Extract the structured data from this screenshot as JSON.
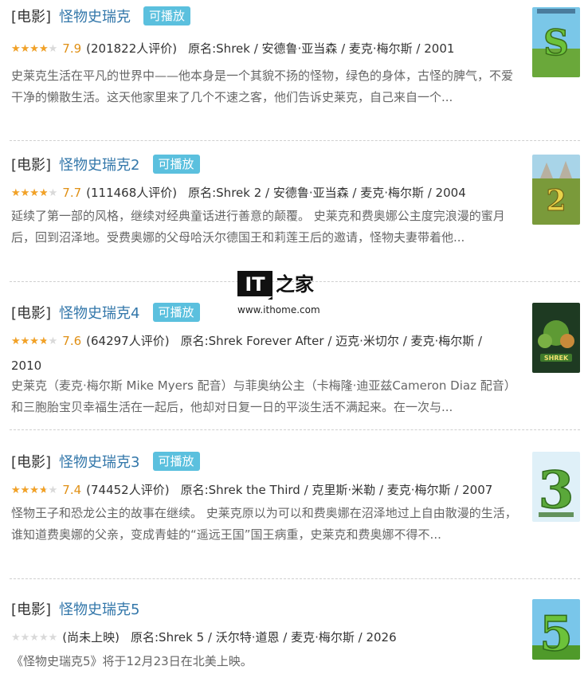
{
  "results": [
    {
      "category": "[电影]",
      "title": "怪物史瑞克",
      "badge": "可播放",
      "rating": 0.79,
      "score": "7.9",
      "votes": "(201822人评价)",
      "original": "原名:Shrek / 安德鲁·亚当森 / 麦克·梅尔斯 / 2001",
      "description": "史莱克生活在平凡的世界中——他本身是一个其貌不扬的怪物，绿色的身体，古怪的脾气，不爱干净的懒散生活。这天他家里来了几个不速之客，他们告诉史莱克，自己来自一个...",
      "poster_number": "",
      "poster_colors": [
        "#7ac7e8",
        "#6aa83a"
      ]
    },
    {
      "category": "[电影]",
      "title": "怪物史瑞克2",
      "badge": "可播放",
      "rating": 0.77,
      "score": "7.7",
      "votes": "(111468人评价)",
      "original": "原名:Shrek 2 / 安德鲁·亚当森 / 麦克·梅尔斯 / 2004",
      "description": "延续了第一部的风格，继续对经典童话进行善意的颠覆。 史莱克和费奥娜公主度完浪漫的蜜月后，回到沼泽地。受费奥娜的父母哈沃尔德国王和莉莲王后的邀请，怪物夫妻带着他...",
      "poster_number": "2",
      "poster_colors": [
        "#a8d4e8",
        "#7a9a3a"
      ]
    },
    {
      "category": "[电影]",
      "title": "怪物史瑞克4",
      "badge": "可播放",
      "rating": 0.76,
      "score": "7.6",
      "votes": "(64297人评价)",
      "original": "原名:Shrek Forever After / 迈克·米切尔 / 麦克·梅尔斯 / 2010",
      "description": "史莱克（麦克·梅尔斯 Mike Myers 配音）与菲奥纳公主（卡梅隆·迪亚兹Cameron Diaz 配音）和三胞胎宝贝幸福生活在一起后，他却对日复一日的平淡生活不满起来。在一次与...",
      "poster_number": "",
      "poster_colors": [
        "#1e3a22",
        "#3f7a2c"
      ]
    },
    {
      "category": "[电影]",
      "title": "怪物史瑞克3",
      "badge": "可播放",
      "rating": 0.74,
      "score": "7.4",
      "votes": "(74452人评价)",
      "original": "原名:Shrek the Third / 克里斯·米勒 / 麦克·梅尔斯 / 2007",
      "description": "怪物王子和恐龙公主的故事在继续。 史莱克原以为可以和费奥娜在沼泽地过上自由散漫的生活，谁知道费奥娜的父亲，变成青蛙的“遥远王国”国王病重，史莱克和费奥娜不得不...",
      "poster_number": "3",
      "poster_colors": [
        "#dff0f8",
        "#5aa83a"
      ]
    },
    {
      "category": "[电影]",
      "title": "怪物史瑞克5",
      "badge": "",
      "rating": 0,
      "score": "",
      "votes": "(尚未上映)",
      "original": "原名:Shrek 5 / 沃尔特·道恩 / 麦克·梅尔斯 / 2026",
      "description": "《怪物史瑞克5》将于12月23日在北美上映。",
      "poster_number": "5",
      "poster_colors": [
        "#79c6ea",
        "#4f9a2a"
      ]
    }
  ],
  "watermark": {
    "logo": "IT之家",
    "logo_left": "IT",
    "logo_right": "之家",
    "url": "www.ithome.com"
  },
  "colors": {
    "title_link": "#3377aa",
    "badge_bg": "#5bc0de",
    "star": "#f3a226",
    "score": "#e09015"
  }
}
